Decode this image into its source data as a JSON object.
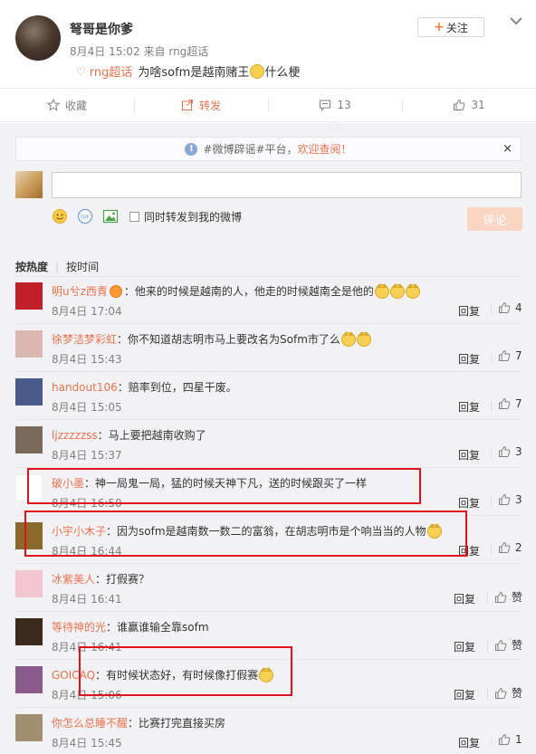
{
  "post": {
    "author": "弩哥是你爹",
    "date": "8月4日 15:02",
    "source_prefix": "来自",
    "source": "rng超话",
    "topic": "rng超话",
    "text_before_emoji": "为啥sofm是越南赌王",
    "text_after_emoji": "什么梗",
    "follow_label": "关注"
  },
  "actions": [
    {
      "label": "收藏",
      "icon": "star-icon"
    },
    {
      "label": "转发",
      "icon": "forward-icon"
    },
    {
      "label": "13",
      "icon": "comment-icon"
    },
    {
      "label": "31",
      "icon": "thumb-up-icon"
    }
  ],
  "notice": {
    "prefix": "#微博辟谣#平台，",
    "link": "欢迎查阅！",
    "close": "×"
  },
  "composer": {
    "repost_label": "同时转发到我的微博",
    "submit_label": "评论"
  },
  "sort": {
    "hot": "按热度",
    "time": "按时间"
  },
  "reply_label": "回复",
  "comments": [
    {
      "user": "明u兮z西青",
      "text": "：他来的时候是越南的人，他走的时候越南全是他的",
      "time": "8月4日 17:04",
      "likes": "4",
      "avatar_color": "#c0202a",
      "emojis": 3,
      "badge": true
    },
    {
      "user": "徐梦洁梦彩虹",
      "text": "：你不知道胡志明市马上要改名为Sofm市了么",
      "time": "8月4日 15:43",
      "likes": "7",
      "avatar_color": "#d8b8b0",
      "emojis": 2,
      "badge": false
    },
    {
      "user": "handout106",
      "text": "：赔率到位，四星干废。",
      "time": "8月4日 15:05",
      "likes": "7",
      "avatar_color": "#4a5a8a",
      "emojis": 0,
      "badge": false
    },
    {
      "user": "ljzzzzzss",
      "text": "：马上要把越南收购了",
      "time": "8月4日 15:37",
      "likes": "3",
      "avatar_color": "#7a6a5a",
      "emojis": 0,
      "badge": false
    },
    {
      "user": "破小墨",
      "text": "：神一局鬼一局，猛的时候天神下凡，送的时候跟买了一样",
      "time": "8月4日 16:50",
      "likes": "3",
      "avatar_color": "#ffffff",
      "emojis": 0,
      "badge": false
    },
    {
      "user": "小宇小木子",
      "text": "：因为sofm是越南数一数二的富翁，在胡志明市是个响当当的人物",
      "time": "8月4日 16:44",
      "likes": "2",
      "avatar_color": "#8a6a2a",
      "emojis": 1,
      "badge": false
    },
    {
      "user": "冰紫美人",
      "text": "：打假赛？",
      "time": "8月4日 16:41",
      "likes": "赞",
      "avatar_color": "#f2c6cf",
      "emojis": 0,
      "badge": false
    },
    {
      "user": "等待神的光",
      "text": "：谁赢谁输全靠sofm",
      "time": "8月4日 16:41",
      "likes": "赞",
      "avatar_color": "#3a2a1a",
      "emojis": 0,
      "badge": false
    },
    {
      "user": "GOICAQ",
      "text": "：有时候状态好，有时候像打假赛",
      "time": "8月4日 15:06",
      "likes": "赞",
      "avatar_color": "#8a5a8a",
      "emojis": 1,
      "badge": false
    },
    {
      "user": "你怎么总睡不醒",
      "text": "：比赛打完直接买房",
      "time": "8月4日 15:45",
      "likes": "1",
      "avatar_color": "#a09070",
      "emojis": 0,
      "badge": false
    }
  ],
  "colors": {
    "accent": "#eb7350",
    "highlight": "#e0101c",
    "comment_bg": "#f2f2f5"
  }
}
